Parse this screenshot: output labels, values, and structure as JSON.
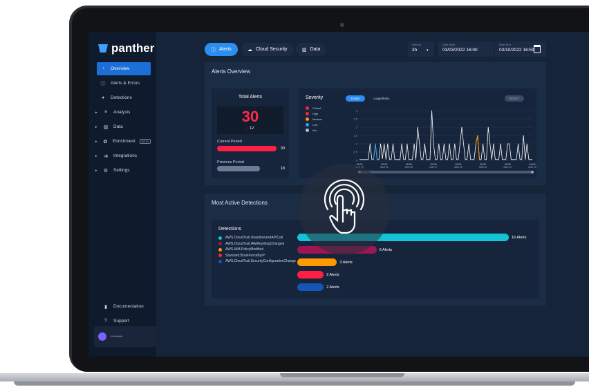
{
  "brand": {
    "name": "panther"
  },
  "sidebar": {
    "items": [
      {
        "label": "Overview",
        "icon": "overview-icon"
      },
      {
        "label": "Alerts & Errors",
        "icon": "alert-icon"
      },
      {
        "label": "Detections",
        "icon": "detections-icon"
      },
      {
        "label": "Analysis",
        "icon": "analysis-icon"
      },
      {
        "label": "Data",
        "icon": "data-icon"
      },
      {
        "label": "Enrichment",
        "icon": "enrichment-icon",
        "badge": "BETA"
      },
      {
        "label": "Integrations",
        "icon": "integrations-icon"
      },
      {
        "label": "Settings",
        "icon": "settings-icon"
      }
    ],
    "footer": [
      {
        "label": "Documentation",
        "icon": "book-icon"
      },
      {
        "label": "Support",
        "icon": "help-icon"
      }
    ],
    "user": {
      "name": "▪▪ ▪▪▪▪▪▪▪"
    }
  },
  "header": {
    "tabs": [
      {
        "label": "Alerts",
        "icon": "alert-icon"
      },
      {
        "label": "Cloud Security",
        "icon": "cloud-icon"
      },
      {
        "label": "Data",
        "icon": "data-icon"
      }
    ],
    "interval": {
      "label": "Interval",
      "value": "3h"
    },
    "date_start": {
      "label": "Date Start",
      "value": "03/03/2022 16:00"
    },
    "date_end": {
      "label": "Date End",
      "value": "03/10/2022 16:59"
    }
  },
  "alerts_overview": {
    "title": "Alerts Overview",
    "total": {
      "title": "Total Alerts",
      "value": "30",
      "delta_sign": "↓",
      "delta": "12",
      "current_label": "Current Period",
      "current_value": "30",
      "previous_label": "Previous Period",
      "previous_value": "18"
    },
    "severity": {
      "title": "Severity",
      "legend": [
        {
          "label": "Critical",
          "color": "#ff1f44"
        },
        {
          "label": "High",
          "color": "#ff1f44"
        },
        {
          "label": "Medium",
          "color": "#ff9900"
        },
        {
          "label": "Low",
          "color": "#2e9cf0"
        },
        {
          "label": "Info",
          "color": "#b4bccb"
        }
      ],
      "scale_linear": "Linear",
      "scale_log": "Logarithmic",
      "reset": "RESET"
    }
  },
  "chart_data": {
    "type": "line",
    "yticks": [
      "0",
      "0.5",
      "1",
      "1.5",
      "2",
      "2.5",
      "3"
    ],
    "xticks": [
      {
        "time": "16:00",
        "date": "MAR 03"
      },
      {
        "time": "00:00",
        "date": "MAR 05"
      },
      {
        "time": "00:00",
        "date": "MAR 06"
      },
      {
        "time": "00:00",
        "date": "MAR 07"
      },
      {
        "time": "00:00",
        "date": "MAR 08"
      },
      {
        "time": "00:00",
        "date": "MAR 09"
      },
      {
        "time": "00:00",
        "date": "MAR 10"
      },
      {
        "time": "16:00",
        "date": "MAR 10"
      }
    ],
    "ylim": [
      0,
      3
    ],
    "series": [
      {
        "color": "#ffffff",
        "values": [
          0.05,
          0.05,
          0.05,
          0.05,
          0.05,
          0.05,
          1,
          0.05,
          0.05,
          1,
          0.05,
          0.05,
          1,
          0.1,
          1,
          0.05,
          1,
          0.05,
          0.05,
          1,
          0.05,
          0.05,
          0.05,
          0.05,
          1,
          0.05,
          0.05,
          1,
          0.05,
          0.05,
          0.05,
          1,
          0.05,
          2,
          1,
          0.05,
          0.05,
          1,
          0.05,
          0.05,
          0.05,
          3,
          1,
          0.05,
          0.05,
          1,
          0.05,
          0.05,
          1,
          0.05,
          0.05,
          1,
          0.05,
          0.05,
          1,
          0.05,
          0.05,
          1,
          2,
          1,
          0.05,
          0.05,
          1,
          0.05,
          0.05,
          0.05,
          1,
          1.5,
          0.05,
          0.05,
          1,
          0.05,
          0.05,
          2,
          1,
          0.05,
          1,
          0.05,
          0.05,
          0.05,
          1,
          0.05,
          0.05,
          0.05,
          1,
          1,
          0.05,
          0.05,
          0.05,
          0.05,
          1,
          0.05,
          0.05,
          1.5,
          0.05,
          1,
          0.05,
          0.05,
          0.05
        ]
      },
      {
        "color": "#2e9cf0",
        "values": [
          null,
          null,
          null,
          null,
          null,
          null,
          null,
          null,
          null,
          1,
          null
        ]
      },
      {
        "color": "#ff9900",
        "values": []
      }
    ]
  },
  "detections": {
    "title": "Most Active Detections",
    "legend_title": "Detections",
    "items": [
      {
        "name": "AWS.CloudTrail.UnauthorizedAPICall",
        "color": "#12c4d6",
        "alerts": "16 Alerts",
        "value": 16
      },
      {
        "name": "AWS.CloudTrail.IAMAnythingChanged",
        "color": "#9e1654",
        "alerts": "6 Alerts",
        "value": 6
      },
      {
        "name": "AWS.IAM.PolicyModified",
        "color": "#ff9900",
        "alerts": "3 Alerts",
        "value": 3
      },
      {
        "name": "Standard.BruteForceByIP",
        "color": "#ff1f44",
        "alerts": "2 Alerts",
        "value": 2
      },
      {
        "name": "AWS.CloudTrail.SecurityConfigurationChange",
        "color": "#1655b8",
        "alerts": "2 Alerts",
        "value": 2
      }
    ]
  },
  "colors": {
    "accent": "#2b8ef0",
    "danger": "#ff2a4a"
  }
}
